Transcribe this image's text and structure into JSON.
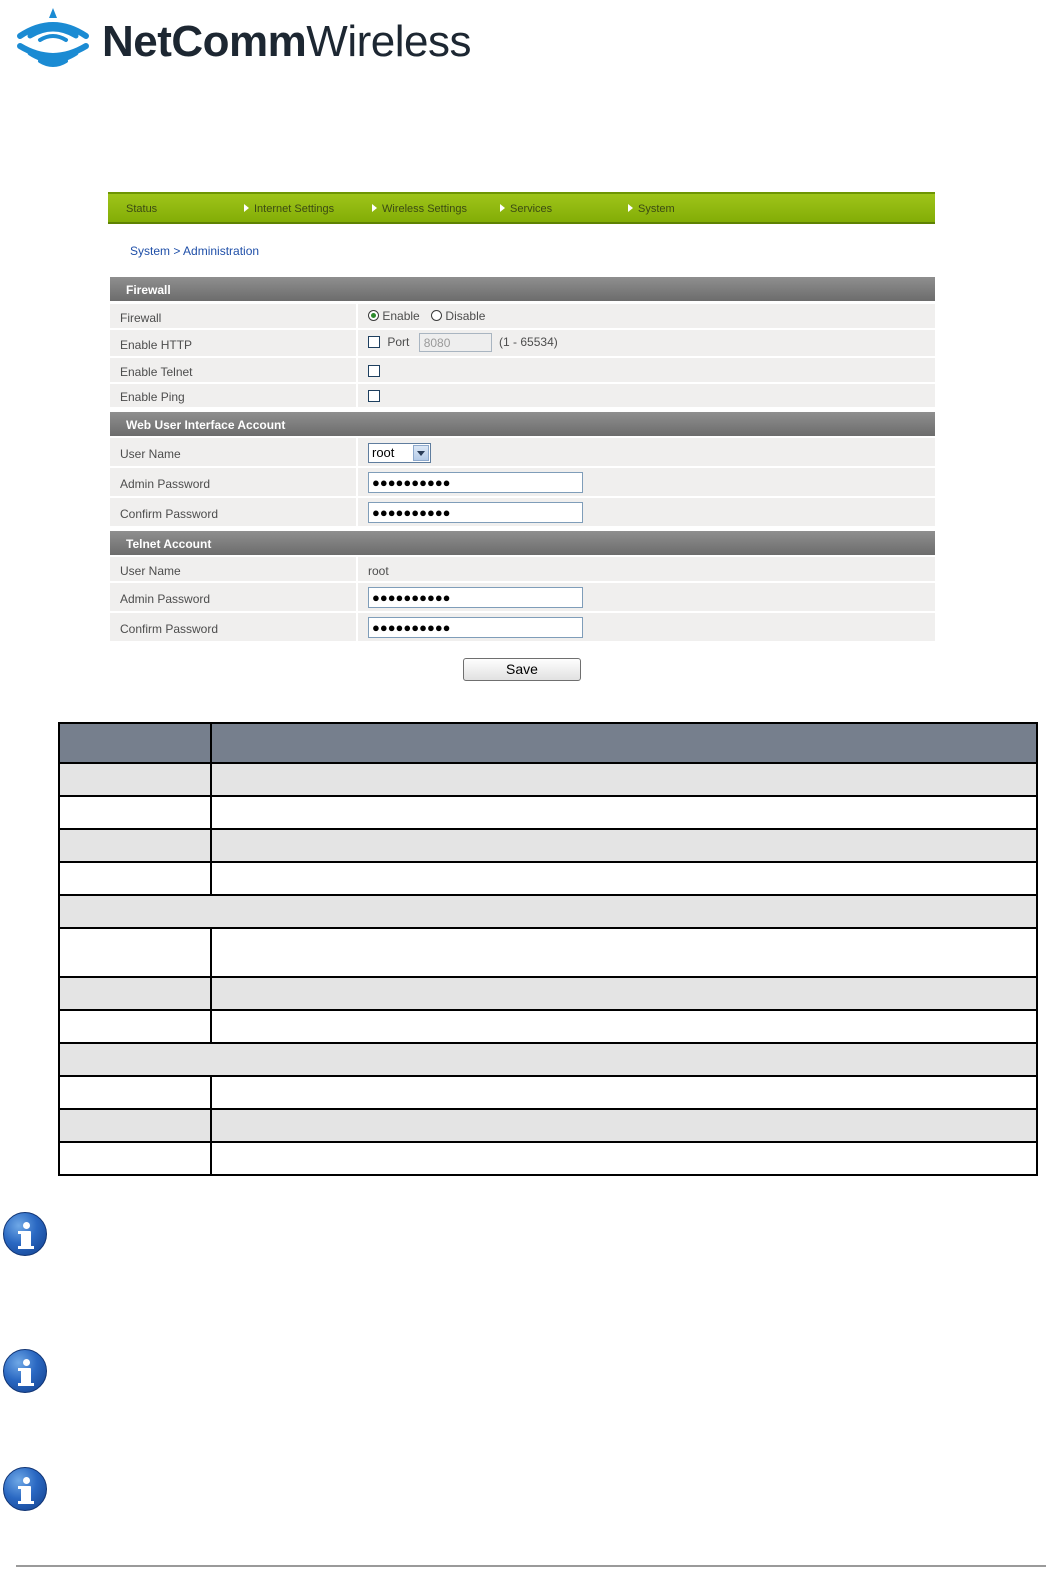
{
  "brand": {
    "logo_bold": "NetComm",
    "logo_light": "Wireless"
  },
  "nav": {
    "items": [
      {
        "label": "Status",
        "arrow": false
      },
      {
        "label": "Internet Settings",
        "arrow": true
      },
      {
        "label": "Wireless Settings",
        "arrow": true
      },
      {
        "label": "Services",
        "arrow": true
      },
      {
        "label": "System",
        "arrow": true
      }
    ]
  },
  "breadcrumb": "System > Administration",
  "firewall": {
    "section_title": "Firewall",
    "firewall_label": "Firewall",
    "enable_option": "Enable",
    "disable_option": "Disable",
    "selected": "Enable",
    "http_label": "Enable HTTP",
    "port_label": "Port",
    "port_value": "8080",
    "port_range": "(1 - 65534)",
    "telnet_label": "Enable Telnet",
    "ping_label": "Enable Ping"
  },
  "web_account": {
    "section_title": "Web User Interface Account",
    "username_label": "User Name",
    "username_value": "root",
    "admin_pw_label": "Admin Password",
    "admin_pw_value": "●●●●●●●●●●",
    "confirm_pw_label": "Confirm Password",
    "confirm_pw_value": "●●●●●●●●●●"
  },
  "telnet_account": {
    "section_title": "Telnet Account",
    "username_label": "User Name",
    "username_value": "root",
    "admin_pw_label": "Admin Password",
    "admin_pw_value": "●●●●●●●●●●",
    "confirm_pw_label": "Confirm Password",
    "confirm_pw_value": "●●●●●●●●●●"
  },
  "save_label": "Save",
  "colors": {
    "nav_green": "#8fb80e",
    "section_grey": "#7a7a7a",
    "link_blue": "#1f4fa8",
    "table_header": "#767f8d"
  }
}
